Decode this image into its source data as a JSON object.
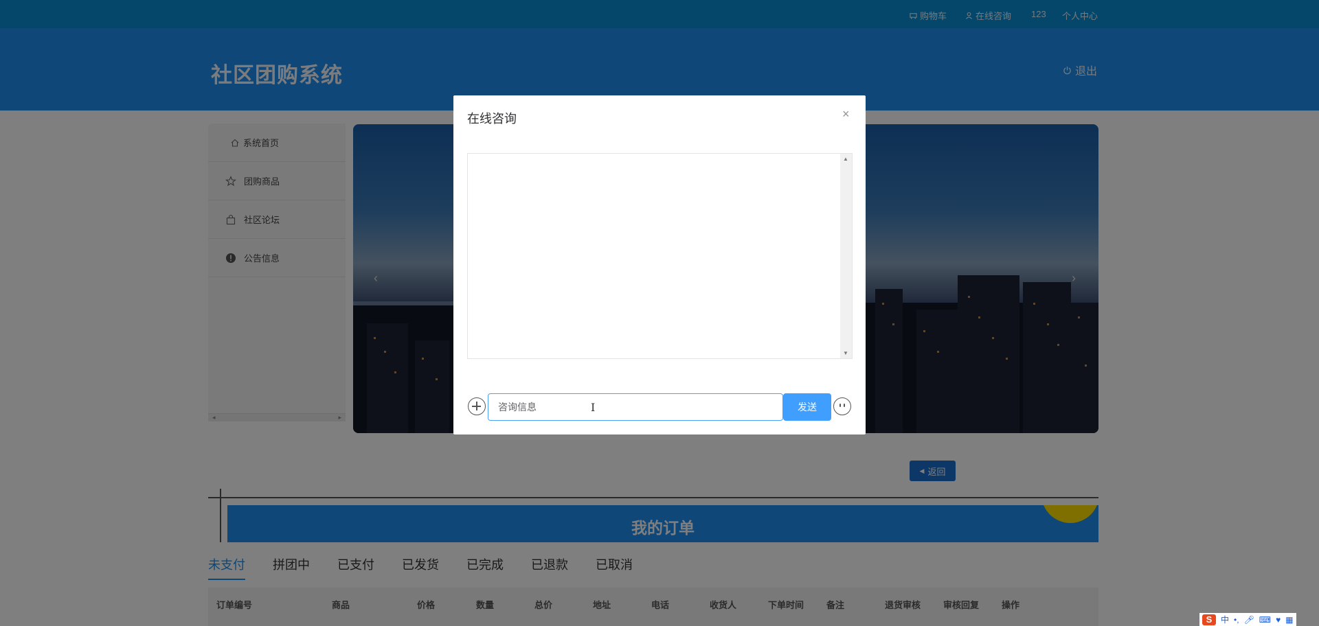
{
  "topbar": {
    "cart": "购物车",
    "consult": "在线咨询",
    "username": "123",
    "profile": "个人中心"
  },
  "header": {
    "title": "社区团购系统",
    "logout": "退出"
  },
  "sidebar": {
    "items": [
      {
        "label": "系统首页",
        "icon": "home-icon"
      },
      {
        "label": "团购商品",
        "icon": "star-icon"
      },
      {
        "label": "社区论坛",
        "icon": "bag-icon"
      },
      {
        "label": "公告信息",
        "icon": "info-icon"
      }
    ]
  },
  "banner": {
    "prev": "‹",
    "next": "›"
  },
  "back_button": "返回",
  "orders": {
    "title": "我的订单",
    "tabs": [
      "未支付",
      "拼团中",
      "已支付",
      "已发货",
      "已完成",
      "已退款",
      "已取消"
    ],
    "active_tab": "未支付",
    "columns": [
      "订单编号",
      "商品",
      "价格",
      "数量",
      "总价",
      "地址",
      "电话",
      "收货人",
      "下单时间",
      "备注",
      "退货审核",
      "审核回复",
      "操作"
    ]
  },
  "dialog": {
    "title": "在线咨询",
    "close": "×",
    "input_value": "咨询信息",
    "send": "发送"
  },
  "ime": {
    "logo": "S",
    "lang": "中"
  },
  "colors": {
    "header": "#1d8ff0",
    "topbar": "#0a8fd6",
    "send": "#409eff",
    "deco": "#ffdc00"
  }
}
